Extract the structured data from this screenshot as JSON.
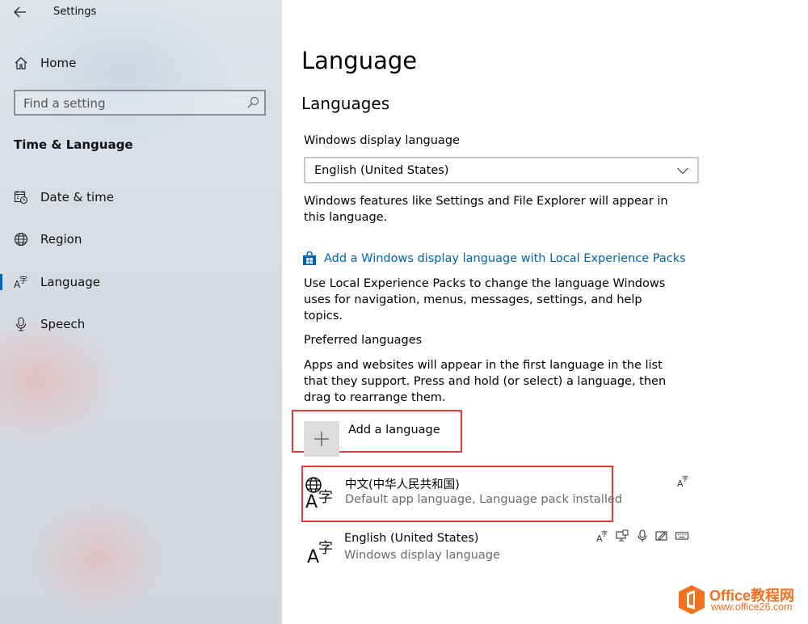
{
  "window": {
    "app_title": "Settings"
  },
  "sidebar": {
    "home_label": "Home",
    "search": {
      "placeholder": "Find a setting"
    },
    "section_title": "Time & Language",
    "items": [
      {
        "label": "Date & time",
        "icon": "calendar-clock-icon",
        "selected": false
      },
      {
        "label": "Region",
        "icon": "globe-icon",
        "selected": false
      },
      {
        "label": "Language",
        "icon": "language-icon",
        "selected": true
      },
      {
        "label": "Speech",
        "icon": "microphone-icon",
        "selected": false
      }
    ],
    "accent_color": "#0067c0"
  },
  "main": {
    "page_title": "Language",
    "section_title": "Languages",
    "display_language": {
      "label": "Windows display language",
      "selected_value": "English (United States)",
      "description": "Windows features like Settings and File Explorer will appear in this language."
    },
    "local_experience": {
      "link_text": "Add a Windows display language with Local Experience Packs",
      "description": "Use Local Experience Packs to change the language Windows uses for navigation, menus, messages, settings, and help topics."
    },
    "preferred": {
      "label": "Preferred languages",
      "description": "Apps and websites will appear in the first language in the list that they support. Press and hold (or select) a language, then drag to rearrange them.",
      "add_label": "Add a language",
      "languages": [
        {
          "name": "中文(中华人民共和国)",
          "status": "Default app language, Language pack installed",
          "features": [
            "language-pack-icon"
          ]
        },
        {
          "name": "English (United States)",
          "status": "Windows display language",
          "features": [
            "language-pack-icon",
            "display-icon",
            "microphone-icon",
            "handwriting-icon",
            "keyboard-icon"
          ]
        }
      ]
    },
    "highlight_color": "#e83a3a",
    "link_color": "#0063b1"
  },
  "watermark": {
    "brand": "Office教程网",
    "url": "www.office26.com",
    "color": "#f37021"
  }
}
